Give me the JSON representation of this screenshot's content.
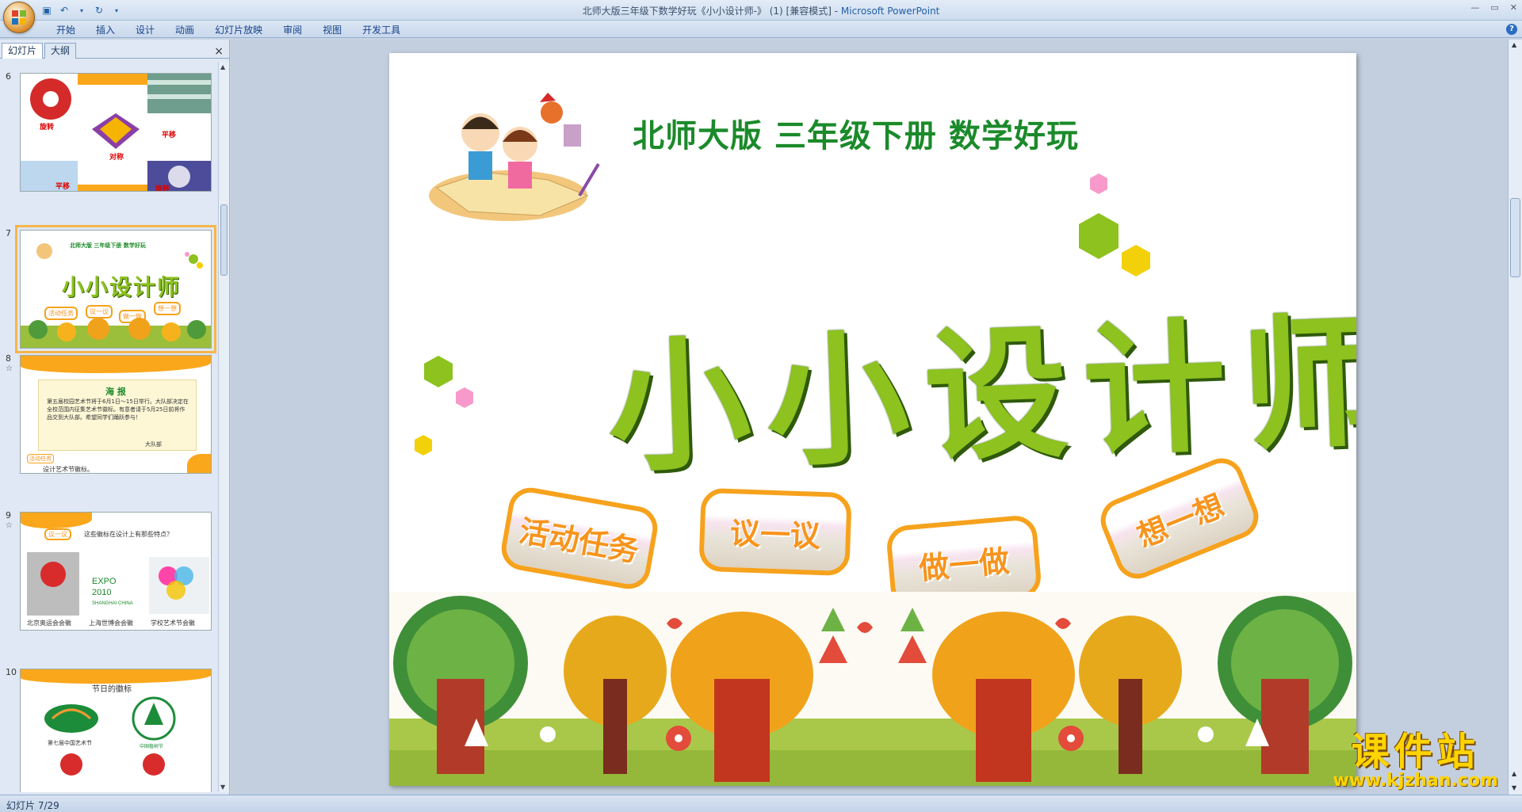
{
  "window": {
    "title_doc": "北师大版三年级下数学好玩《小小设计师-》 (1) [兼容模式] - ",
    "title_app": "Microsoft PowerPoint"
  },
  "ribbon": {
    "tabs": [
      "开始",
      "插入",
      "设计",
      "动画",
      "幻灯片放映",
      "审阅",
      "视图",
      "开发工具"
    ]
  },
  "panel": {
    "tab_slides": "幻灯片",
    "tab_outline": "大纲",
    "close": "×"
  },
  "thumbnails": [
    {
      "num": "6",
      "labels": [
        "旋转",
        "平移",
        "对称",
        "平移",
        "旋转"
      ]
    },
    {
      "num": "7",
      "header": "北师大版 三年级下册 数学好玩",
      "title": "小小设计师",
      "buttons": [
        "活动任务",
        "议一议",
        "做一做",
        "想一想"
      ]
    },
    {
      "num": "8",
      "heading": "海 报",
      "body": "第五届校园艺术节将于6月1日～15日举行。大队部决定在全校范围内征集艺术节徽标。有意者请于5月25日前将作品交到大队部。希望同学们踊跃参与！",
      "sign": "大队部",
      "badge": "活动任务",
      "caption": "设计艺术节徽标。"
    },
    {
      "num": "9",
      "badge": "议一议",
      "question": "这些徽标在设计上有那些特点？",
      "captions": [
        "北京奥运会会徽",
        "上海世博会会徽",
        "学校艺术节会徽"
      ]
    },
    {
      "num": "10",
      "heading": "节日的徽标",
      "captions": [
        "第七届中国艺术节",
        "中国植树节"
      ]
    }
  ],
  "slide": {
    "subtitle": "北师大版  三年级下册  数学好玩",
    "title": "小小设计师",
    "buttons": [
      "活动任务",
      "议一议",
      "做一做",
      "想一想"
    ]
  },
  "watermark": {
    "text": "课件站",
    "url": "www.kjzhan.com"
  },
  "status": {
    "slide_indicator": "幻灯片 7/29"
  },
  "colors": {
    "accent_orange": "#f6a21d",
    "title_green": "#8dc21f",
    "subtitle_green": "#1b8a2a"
  }
}
